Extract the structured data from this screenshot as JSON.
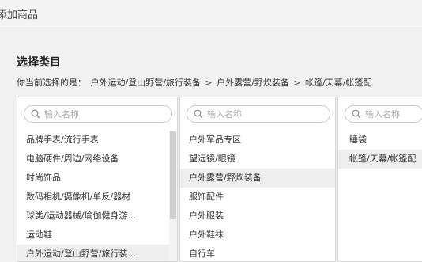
{
  "window": {
    "title": "添加商品"
  },
  "section": {
    "title": "选择类目"
  },
  "path": {
    "prefix": "你当前选择的是：",
    "level1": "户外运动/登山野营/旅行装备",
    "sep": ">",
    "level2": "户外露营/野炊装备",
    "level3": "帐篷/天幕/帐篷配"
  },
  "panels": [
    {
      "search_placeholder": "输入名称",
      "items": [
        {
          "label": "品牌手表/流行手表"
        },
        {
          "label": "电脑硬件/周边/网络设备"
        },
        {
          "label": "时尚饰品"
        },
        {
          "label": "数码相机/摄像机/单反/器材"
        },
        {
          "label": "球类/运动器械/瑜伽健身游..."
        },
        {
          "label": "运动鞋"
        },
        {
          "label": "户外运动/登山野营/旅行装..."
        }
      ],
      "selected_index": 6
    },
    {
      "search_placeholder": "输入名称",
      "items": [
        {
          "label": "户外军品专区"
        },
        {
          "label": "望远镜/眼镜"
        },
        {
          "label": "户外露营/野炊装备"
        },
        {
          "label": "服饰配件"
        },
        {
          "label": "户外服装"
        },
        {
          "label": "户外鞋袜"
        },
        {
          "label": "自行车"
        }
      ],
      "selected_index": 2
    },
    {
      "search_placeholder": "输入名称",
      "items": [
        {
          "label": "睡袋"
        },
        {
          "label": "帐篷/天幕/帐篷配"
        }
      ],
      "selected_index": 1
    }
  ]
}
